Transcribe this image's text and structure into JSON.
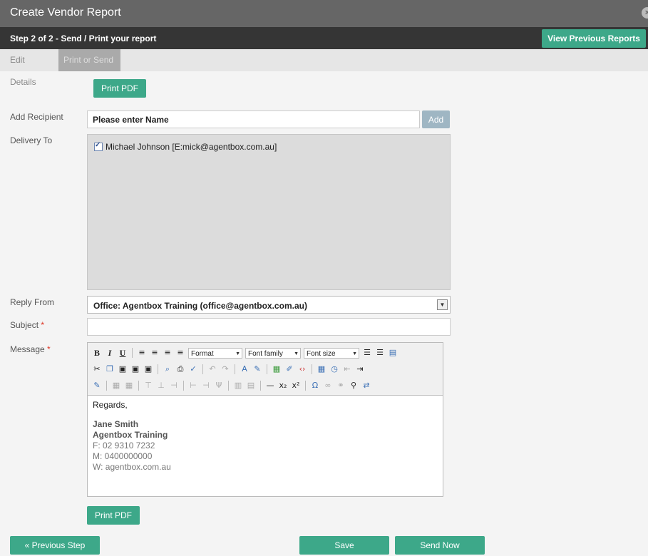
{
  "window": {
    "title": "Create Vendor Report"
  },
  "stepbar": {
    "step_label": "Step 2 of 2 - Send / Print your report",
    "view_previous_label": "View Previous Reports"
  },
  "tabs": [
    {
      "label": "Edit Details",
      "active": false
    },
    {
      "label": "Print or Send",
      "active": true
    }
  ],
  "top_print_pdf_label": "Print PDF",
  "add_recipient": {
    "label": "Add Recipient",
    "value": "Please enter Name",
    "add_label": "Add"
  },
  "delivery": {
    "label": "Delivery To",
    "items": [
      {
        "text": "Michael Johnson [E:mick@agentbox.com.au]",
        "checked": true
      }
    ]
  },
  "reply_from": {
    "label": "Reply From",
    "value": "Office: Agentbox Training (office@agentbox.com.au)"
  },
  "subject": {
    "label": "Subject",
    "required_mark": "*",
    "value": ""
  },
  "message": {
    "label": "Message",
    "required_mark": "*",
    "toolbar": {
      "format_label": "Format",
      "font_family_label": "Font family",
      "font_size_label": "Font size"
    },
    "body": {
      "greeting": "Regards,",
      "name": "Jane Smith",
      "company": "Agentbox Training",
      "fax": "F: 02 9310 7232",
      "mobile": "M: 0400000000",
      "web": "W: agentbox.com.au"
    }
  },
  "bottom_print_pdf_label": "Print PDF",
  "footer": {
    "previous_label": "« Previous Step",
    "save_label": "Save",
    "send_label": "Send Now"
  },
  "colors": {
    "accent": "#3da889",
    "titlebar": "#666666",
    "stepbar": "#353535"
  }
}
